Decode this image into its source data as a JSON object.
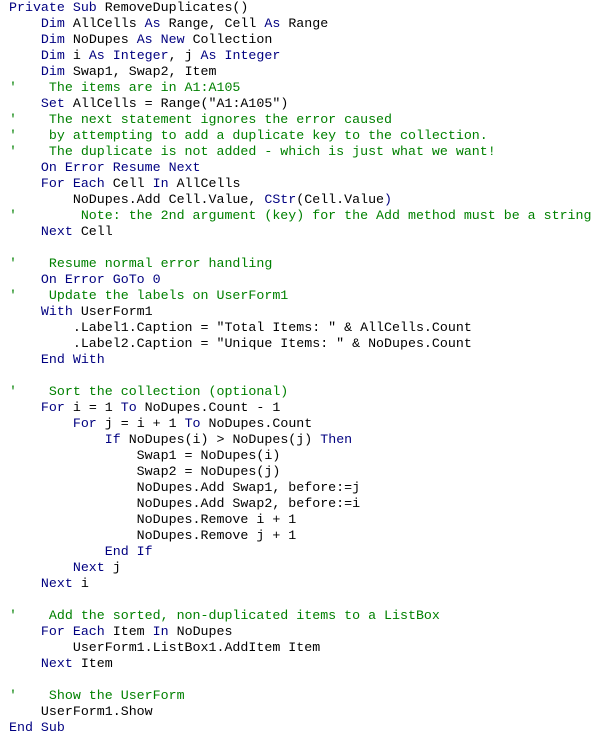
{
  "colors": {
    "keyword": "#000080",
    "comment": "#008000",
    "text": "#000000",
    "background": "#ffffff"
  },
  "code_lines": [
    [
      [
        "kw",
        "Private Sub"
      ],
      [
        "tx",
        " RemoveDuplicates()"
      ]
    ],
    [
      [
        "tx",
        "    "
      ],
      [
        "kw",
        "Dim"
      ],
      [
        "tx",
        " AllCells "
      ],
      [
        "kw",
        "As"
      ],
      [
        "tx",
        " Range, Cell "
      ],
      [
        "kw",
        "As"
      ],
      [
        "tx",
        " Range"
      ]
    ],
    [
      [
        "tx",
        "    "
      ],
      [
        "kw",
        "Dim"
      ],
      [
        "tx",
        " NoDupes "
      ],
      [
        "kw",
        "As New"
      ],
      [
        "tx",
        " Collection"
      ]
    ],
    [
      [
        "tx",
        "    "
      ],
      [
        "kw",
        "Dim"
      ],
      [
        "tx",
        " i "
      ],
      [
        "kw",
        "As Integer"
      ],
      [
        "tx",
        ", j "
      ],
      [
        "kw",
        "As Integer"
      ]
    ],
    [
      [
        "tx",
        "    "
      ],
      [
        "kw",
        "Dim"
      ],
      [
        "tx",
        " Swap1, Swap2, Item"
      ]
    ],
    [
      [
        "cm",
        "'    The items are in A1:A105"
      ]
    ],
    [
      [
        "tx",
        "    "
      ],
      [
        "kw",
        "Set"
      ],
      [
        "tx",
        " AllCells = Range(\"A1:A105\")"
      ]
    ],
    [
      [
        "cm",
        "'    The next statement ignores the error caused"
      ]
    ],
    [
      [
        "cm",
        "'    by attempting to add a duplicate key to the collection."
      ]
    ],
    [
      [
        "cm",
        "'    The duplicate is not added - which is just what we want!"
      ]
    ],
    [
      [
        "tx",
        "    "
      ],
      [
        "kw",
        "On Error Resume Next"
      ]
    ],
    [
      [
        "tx",
        "    "
      ],
      [
        "kw",
        "For Each"
      ],
      [
        "tx",
        " Cell "
      ],
      [
        "kw",
        "In"
      ],
      [
        "tx",
        " AllCells"
      ]
    ],
    [
      [
        "tx",
        "        NoDupes.Add Cell.Value, "
      ],
      [
        "kw",
        "CStr"
      ],
      [
        "tx",
        "(Cell.Value"
      ],
      [
        "kw",
        ")"
      ]
    ],
    [
      [
        "cm",
        "'        Note: the 2nd argument (key) for the Add method must be a string"
      ]
    ],
    [
      [
        "tx",
        "    "
      ],
      [
        "kw",
        "Next"
      ],
      [
        "tx",
        " Cell"
      ]
    ],
    [],
    [
      [
        "cm",
        "'    Resume normal error handling"
      ]
    ],
    [
      [
        "tx",
        "    "
      ],
      [
        "kw",
        "On Error GoTo 0"
      ]
    ],
    [
      [
        "cm",
        "'    Update the labels on UserForm1"
      ]
    ],
    [
      [
        "tx",
        "    "
      ],
      [
        "kw",
        "With"
      ],
      [
        "tx",
        " UserForm1"
      ]
    ],
    [
      [
        "tx",
        "        .Label1.Caption = \"Total Items: \" & AllCells.Count"
      ]
    ],
    [
      [
        "tx",
        "        .Label2.Caption = \"Unique Items: \" & NoDupes.Count"
      ]
    ],
    [
      [
        "tx",
        "    "
      ],
      [
        "kw",
        "End With"
      ]
    ],
    [],
    [
      [
        "cm",
        "'    Sort the collection (optional)"
      ]
    ],
    [
      [
        "tx",
        "    "
      ],
      [
        "kw",
        "For"
      ],
      [
        "tx",
        " i = 1 "
      ],
      [
        "kw",
        "To"
      ],
      [
        "tx",
        " NoDupes.Count - 1"
      ]
    ],
    [
      [
        "tx",
        "        "
      ],
      [
        "kw",
        "For"
      ],
      [
        "tx",
        " j = i + 1 "
      ],
      [
        "kw",
        "To"
      ],
      [
        "tx",
        " NoDupes.Count"
      ]
    ],
    [
      [
        "tx",
        "            "
      ],
      [
        "kw",
        "If"
      ],
      [
        "tx",
        " NoDupes(i) > NoDupes(j) "
      ],
      [
        "kw",
        "Then"
      ]
    ],
    [
      [
        "tx",
        "                Swap1 = NoDupes(i)"
      ]
    ],
    [
      [
        "tx",
        "                Swap2 = NoDupes(j)"
      ]
    ],
    [
      [
        "tx",
        "                NoDupes.Add Swap1, before:=j"
      ]
    ],
    [
      [
        "tx",
        "                NoDupes.Add Swap2, before:=i"
      ]
    ],
    [
      [
        "tx",
        "                NoDupes.Remove i + 1"
      ]
    ],
    [
      [
        "tx",
        "                NoDupes.Remove j + 1"
      ]
    ],
    [
      [
        "tx",
        "            "
      ],
      [
        "kw",
        "End If"
      ]
    ],
    [
      [
        "tx",
        "        "
      ],
      [
        "kw",
        "Next"
      ],
      [
        "tx",
        " j"
      ]
    ],
    [
      [
        "tx",
        "    "
      ],
      [
        "kw",
        "Next"
      ],
      [
        "tx",
        " i"
      ]
    ],
    [],
    [
      [
        "cm",
        "'    Add the sorted, non-duplicated items to a ListBox"
      ]
    ],
    [
      [
        "tx",
        "    "
      ],
      [
        "kw",
        "For Each"
      ],
      [
        "tx",
        " Item "
      ],
      [
        "kw",
        "In"
      ],
      [
        "tx",
        " NoDupes"
      ]
    ],
    [
      [
        "tx",
        "        UserForm1.ListBox1.AddItem Item"
      ]
    ],
    [
      [
        "tx",
        "    "
      ],
      [
        "kw",
        "Next"
      ],
      [
        "tx",
        " Item"
      ]
    ],
    [],
    [
      [
        "cm",
        "'    Show the UserForm"
      ]
    ],
    [
      [
        "tx",
        "    UserForm1.Show"
      ]
    ],
    [
      [
        "kw",
        "End Sub"
      ]
    ]
  ]
}
